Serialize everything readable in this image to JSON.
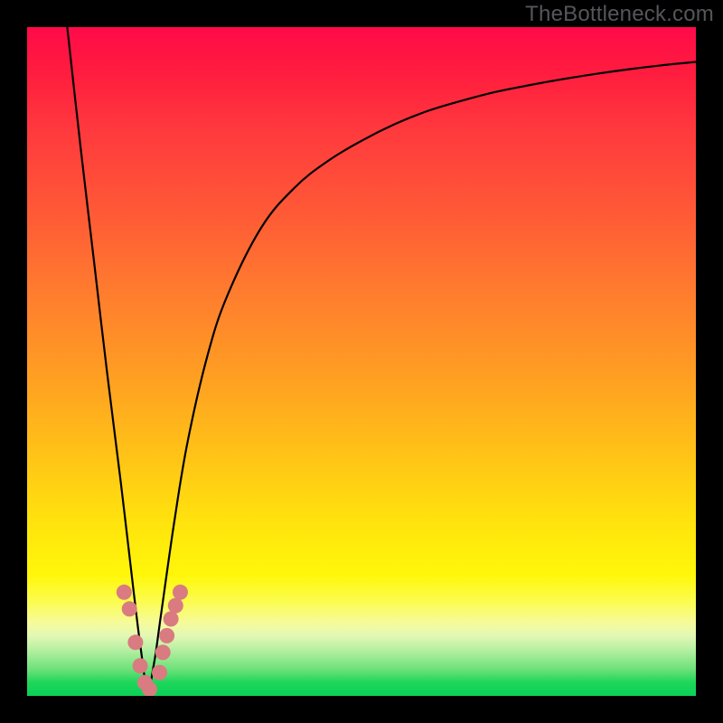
{
  "watermark": "TheBottleneck.com",
  "colors": {
    "frame": "#000000",
    "curve": "#000000",
    "marker_fill": "#d97b80",
    "marker_stroke": "#c46a70",
    "gradient_stops": [
      "#ff0a49",
      "#ff1a3f",
      "#ff3b3d",
      "#ff5a36",
      "#ff7d2e",
      "#ff9e22",
      "#ffc317",
      "#ffe30d",
      "#fff70a",
      "#fbfc52",
      "#f6fb9a",
      "#e3f8b4",
      "#b9f0a3",
      "#6de27a",
      "#1ed65a",
      "#0bd158"
    ]
  },
  "chart_data": {
    "type": "line",
    "title": "",
    "xlabel": "",
    "ylabel": "",
    "xlim": [
      0,
      100
    ],
    "ylim": [
      0,
      100
    ],
    "note": "Axes are unlabeled in the source image; x/y units are normalized percentages of the plot area. Curve is V-shaped with minimum near x≈18. Markers cluster around the valley where the curve intersects the yellow/green band (y roughly 0–15).",
    "series": [
      {
        "name": "bottleneck-curve",
        "x": [
          6,
          8,
          10,
          12,
          14,
          16,
          17,
          18,
          19,
          20,
          22,
          24,
          27,
          30,
          35,
          40,
          45,
          50,
          55,
          60,
          65,
          70,
          75,
          80,
          85,
          90,
          95,
          100
        ],
        "y": [
          100,
          82,
          65,
          48,
          32,
          15,
          7,
          1,
          5,
          12,
          26,
          38,
          51,
          60,
          70,
          76,
          80,
          83,
          85.5,
          87.5,
          89,
          90.3,
          91.3,
          92.2,
          93,
          93.7,
          94.3,
          94.8
        ]
      }
    ],
    "markers": {
      "name": "highlighted-points",
      "x": [
        14.5,
        15.3,
        16.2,
        16.9,
        17.6,
        18.3,
        19.8,
        20.3,
        20.9,
        21.5,
        22.2,
        22.9
      ],
      "y": [
        15.5,
        13.0,
        8.0,
        4.5,
        2.0,
        1.0,
        3.5,
        6.5,
        9.0,
        11.5,
        13.5,
        15.5
      ]
    }
  }
}
